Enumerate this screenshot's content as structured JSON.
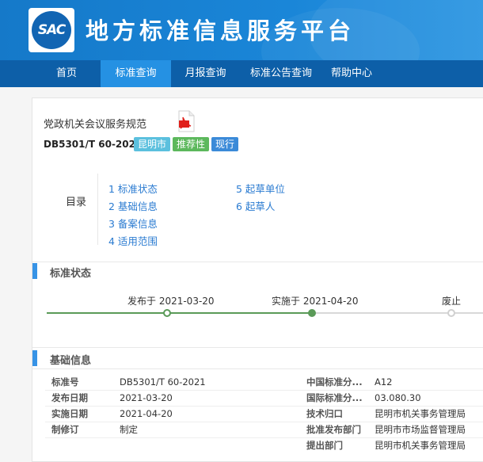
{
  "header": {
    "logo_text": "SAC",
    "site_title": "地方标准信息服务平台"
  },
  "nav": {
    "items": [
      {
        "label": "首页"
      },
      {
        "label": "标准查询"
      },
      {
        "label": "月报查询"
      },
      {
        "label": "标准公告查询"
      },
      {
        "label": "帮助中心"
      }
    ],
    "active_index": 1
  },
  "standard": {
    "title": "党政机关会议服务规范",
    "code": "DB5301/T 60-2021",
    "badges": [
      {
        "label": "昆明市",
        "color": "#5bc0de"
      },
      {
        "label": "推荐性",
        "color": "#5cb85c"
      },
      {
        "label": "现行",
        "color": "#3b8ad8"
      }
    ]
  },
  "toc": {
    "label": "目录",
    "left": [
      "1 标准状态",
      "2 基础信息",
      "3 备案信息",
      "4 适用范围"
    ],
    "right": [
      "5 起草单位",
      "6 起草人"
    ]
  },
  "status_section": {
    "title": "标准状态",
    "publish": "发布于 2021-03-20",
    "implement": "实施于 2021-04-20",
    "abolish": "废止",
    "active_color": "#5a9a58",
    "inactive_color": "#d0d0d0"
  },
  "basic_section": {
    "title": "基础信息",
    "rows": [
      {
        "k1": "标准号",
        "v1": "DB5301/T 60-2021",
        "k2": "中国标准分...",
        "v2": "A12"
      },
      {
        "k1": "发布日期",
        "v1": "2021-03-20",
        "k2": "国际标准分...",
        "v2": "03.080.30"
      },
      {
        "k1": "实施日期",
        "v1": "2021-04-20",
        "k2": "技术归口",
        "v2": "昆明市机关事务管理局"
      },
      {
        "k1": "制修订",
        "v1": "制定",
        "k2": "批准发布部门",
        "v2": "昆明市市场监督管理局"
      },
      {
        "k1": "",
        "v1": "",
        "k2": "提出部门",
        "v2": "昆明市机关事务管理局"
      }
    ]
  }
}
